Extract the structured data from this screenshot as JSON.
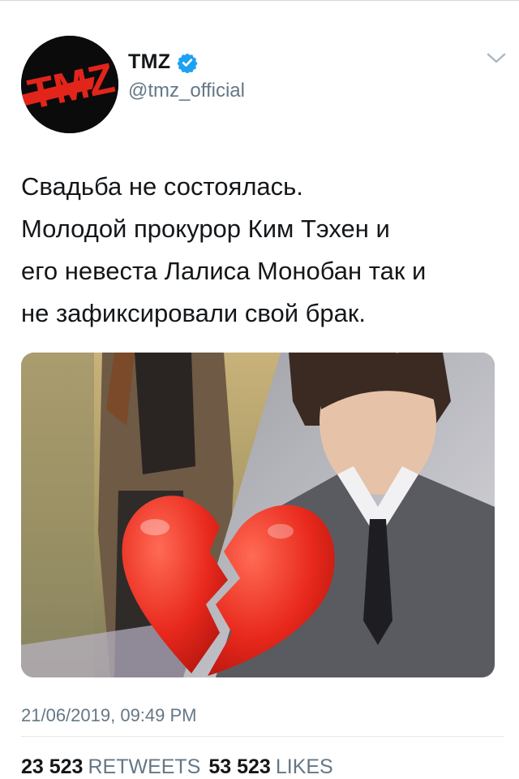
{
  "account": {
    "display_name": "TMZ",
    "handle": "@tmz_official",
    "verified": true,
    "avatar_text": "TMZ",
    "avatar_colors": {
      "background": "#0b0b0b",
      "logo": "#e3241b"
    }
  },
  "tweet": {
    "text_lines": [
      "Свадьба не состоялась.",
      "Молодой прокурор Ким Тэхен и",
      "его невеста Лалиса Монобан так и",
      "не зафиксировали свой брак."
    ],
    "media": {
      "left_panel": "photo-woman-in-plaid-blazer",
      "right_panel": "photo-man-in-grey-suit",
      "overlay_icon": "broken-heart-icon"
    },
    "timestamp": "21/06/2019, 09:49 PM",
    "stats": {
      "retweets_count": "23 523",
      "retweets_label": "RETWEETS",
      "likes_count": "53 523",
      "likes_label": "LIKES"
    }
  },
  "colors": {
    "text_primary": "#14171a",
    "text_secondary": "#657786",
    "verified_blue": "#1da1f2",
    "heart_red": "#e8281c"
  }
}
